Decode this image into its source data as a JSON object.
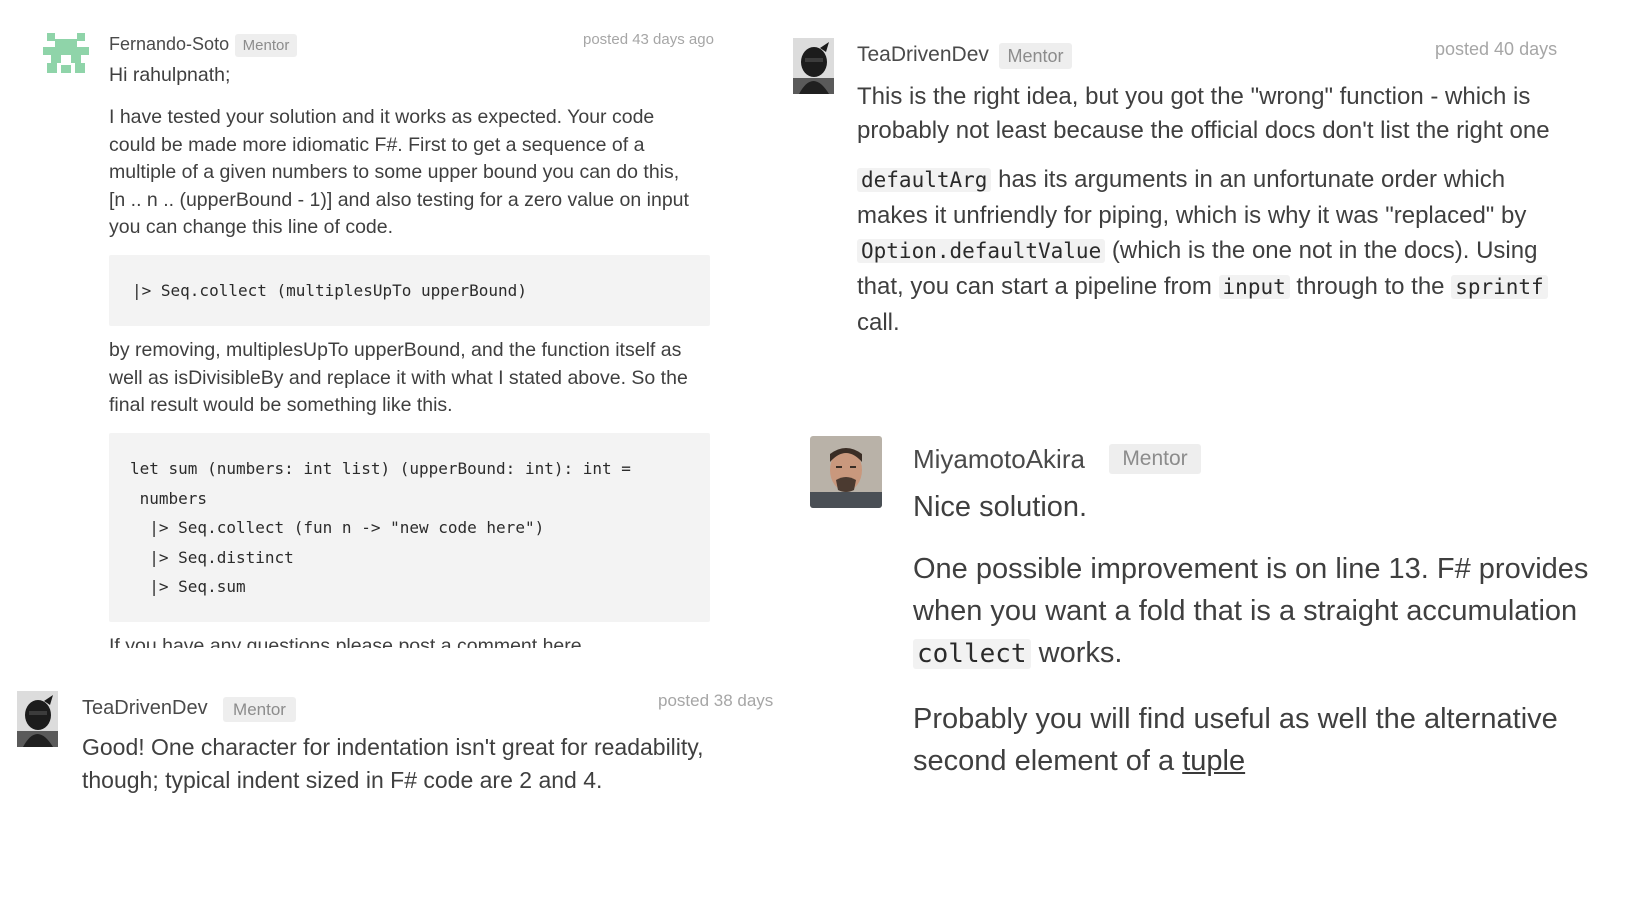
{
  "comment1": {
    "author": "Fernando-Soto",
    "badge": "Mentor",
    "posted": "posted 43 days ago",
    "greeting": "Hi rahulpnath;",
    "p1_lines": [
      "I have tested your solution and it works as expected. Your code",
      "could be made more idiomatic F#. First to get a sequence of a",
      "multiple of a given numbers to some upper bound you can do this,",
      "[n .. n .. (upperBound - 1)] and also testing for a zero value on input",
      "you can change this line of code."
    ],
    "code1": "|> Seq.collect (multiplesUpTo upperBound)",
    "p2_lines": [
      "by removing, multiplesUpTo upperBound, and the function itself as",
      "well as isDivisibleBy and replace it with what I stated above. So the",
      "final result would be something like this."
    ],
    "code2": [
      "let sum (numbers: int list) (upperBound: int): int =",
      " numbers",
      "  |> Seq.collect (fun n -> \"new code here\")",
      "  |> Seq.distinct",
      "  |> Seq.sum"
    ],
    "cut_line": "If you have any questions please post a comment here."
  },
  "comment2": {
    "author": "TeaDrivenDev",
    "badge": "Mentor",
    "posted": "posted 40 days",
    "line1": "This is the right idea, but you got the \"wrong\" function - which is",
    "line2": "probably not least because the official docs don't list the right one",
    "code_defaultArg": "defaultArg",
    "line3_rest": " has its arguments in an unfortunate order which",
    "line4": "makes it unfriendly for piping, which is why it was \"replaced\" by",
    "code_defaultValue": "Option.defaultValue",
    "line5_rest": " (which is the one not in the docs). Using",
    "line6_a": "that, you can start a pipeline from ",
    "code_input": "input",
    "line6_b": " through to the ",
    "code_sprintf": "sprintf",
    "line7": "call."
  },
  "comment3": {
    "author": "TeaDrivenDev",
    "badge": "Mentor",
    "posted": "posted 38 days",
    "line1": "Good! One character for indentation isn't great for readability,",
    "line2": "though; typical indent sized in F# code are 2 and 4."
  },
  "comment4": {
    "author": "MiyamotoAkira",
    "badge": "Mentor",
    "line1": "Nice solution.",
    "line2": "One possible improvement is on line 13. F# provides",
    "line3": "when you want a fold that is a straight accumulation",
    "code_collect": "collect",
    "line4_rest": " works.",
    "line5": "Probably you will find useful as well the alternative",
    "line6_a": "second element of a ",
    "link_tuple": "tuple"
  }
}
